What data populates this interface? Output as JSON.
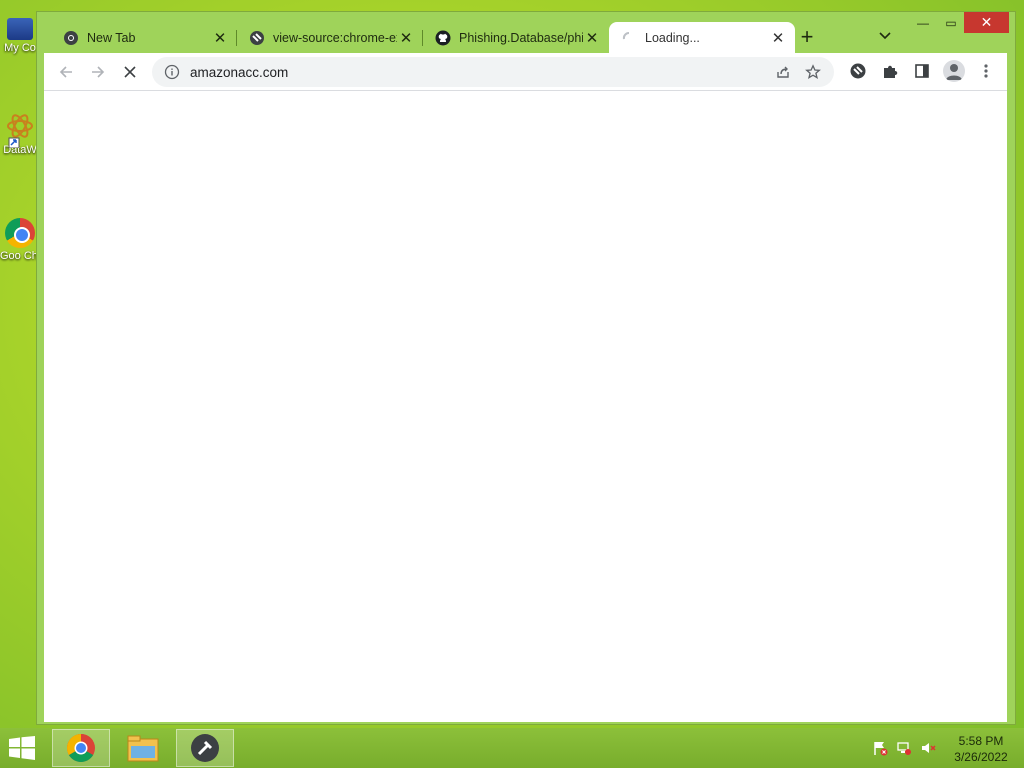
{
  "desktop": {
    "icons": [
      {
        "label": "My Co"
      },
      {
        "label": "DataW"
      },
      {
        "label": "Goo Chr"
      }
    ]
  },
  "tabs": [
    {
      "title": "New Tab",
      "icon": "chrome-icon"
    },
    {
      "title": "view-source:chrome-ex",
      "icon": "extension-globe-icon"
    },
    {
      "title": "Phishing.Database/phi",
      "icon": "github-icon"
    },
    {
      "title": "Loading...",
      "icon": "loading-spinner-icon",
      "active": true
    }
  ],
  "toolbar": {
    "url": "amazonacc.com"
  },
  "taskbar": {
    "time": "5:58 PM",
    "date": "3/26/2022"
  },
  "colors": {
    "frame": "#9fd35a",
    "close_button": "#c7372f",
    "taskbar": "#80b532"
  }
}
